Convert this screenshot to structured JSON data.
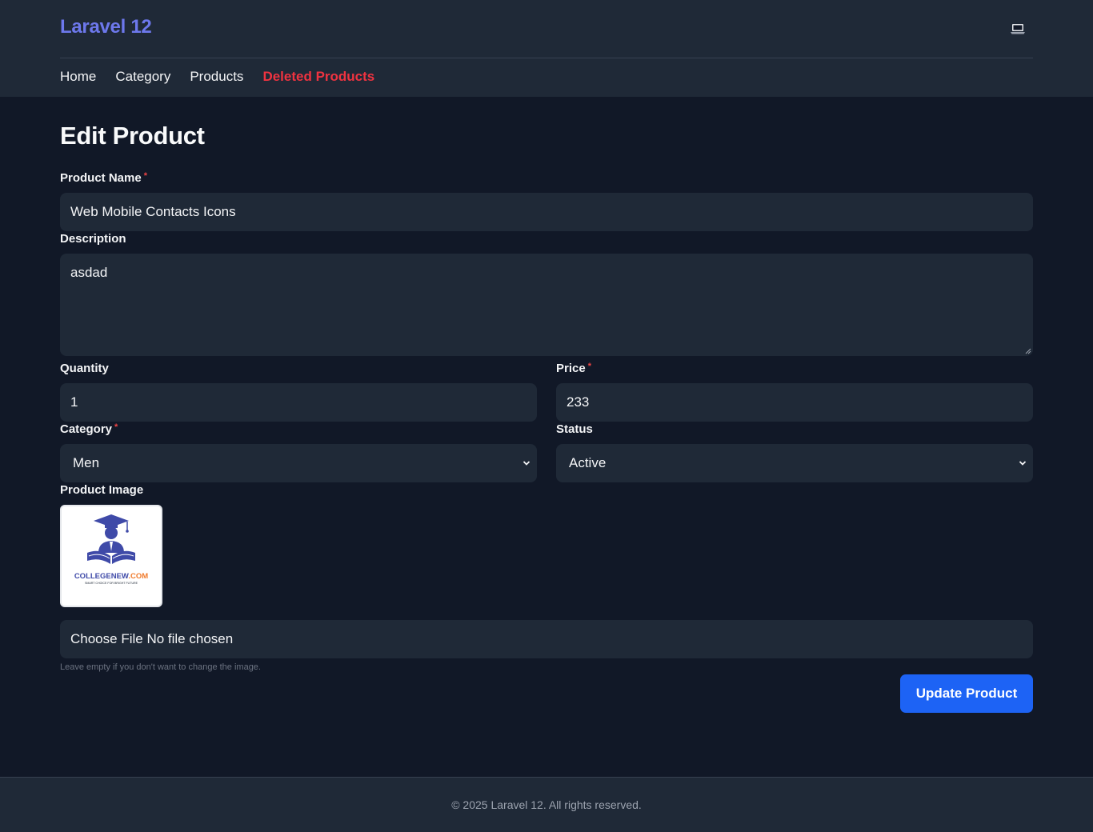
{
  "header": {
    "brand": "Laravel 12",
    "theme_toggle_icon": "laptop-icon",
    "nav": [
      {
        "label": "Home"
      },
      {
        "label": "Category"
      },
      {
        "label": "Products"
      },
      {
        "label": "Deleted Products",
        "color": "#ef3340"
      }
    ],
    "brand_color": "#6d78ec"
  },
  "form": {
    "title": "Edit Product",
    "product_name": {
      "label": "Product Name",
      "required_mark": "*",
      "value": "Web Mobile Contacts Icons"
    },
    "description": {
      "label": "Description",
      "value": "asdad"
    },
    "quantity": {
      "label": "Quantity",
      "value": "1"
    },
    "price": {
      "label": "Price",
      "required_mark": "*",
      "value": "233"
    },
    "category": {
      "label": "Category",
      "required_mark": "*",
      "selected": "Men"
    },
    "status": {
      "label": "Status",
      "selected": "Active"
    },
    "image": {
      "label": "Product Image",
      "logo_text": "COLLEGENEW",
      "logo_text_suffix": ".COM",
      "logo_tagline": "SMART CHOICE FOR BRIGHT FUTURE",
      "file_button": "Choose File",
      "file_status": "No file chosen",
      "help": "Leave empty if you don't want to change the image."
    },
    "submit_label": "Update Product",
    "accent_color": "#1d63f5"
  },
  "footer": {
    "text": "© 2025 Laravel 12. All rights reserved."
  }
}
